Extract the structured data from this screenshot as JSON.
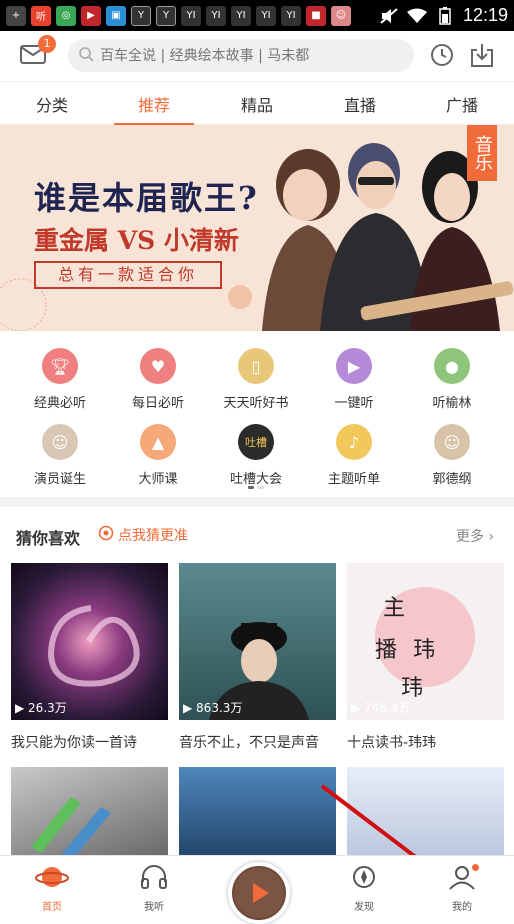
{
  "status_bar": {
    "time": "12:19",
    "left_icons": [
      "plus-icon",
      "ting-app-icon",
      "wechat-icon",
      "video-icon",
      "qr-icon",
      "y-icon",
      "y-icon",
      "yi-icon",
      "yi-icon",
      "yi-icon",
      "yi-icon",
      "yi-icon",
      "bookmark-icon",
      "face-icon"
    ]
  },
  "topbar": {
    "mail_badge": "1",
    "search_placeholder": "百车全说 | 经典绘本故事 | 马未都"
  },
  "tabs": [
    "分类",
    "推荐",
    "精品",
    "直播",
    "广播"
  ],
  "active_tab": "推荐",
  "banner": {
    "title": "谁是本届歌王?",
    "subtitle": "重金属 VS 小清新",
    "tagline": "总有一款适合你",
    "tag": "音乐"
  },
  "categories_row1": [
    {
      "label": "经典必听",
      "icon": "trophy-icon",
      "color": "#f08080"
    },
    {
      "label": "每日必听",
      "icon": "calendar-icon",
      "color": "#f08080"
    },
    {
      "label": "天天听好书",
      "icon": "book-icon",
      "color": "#e7c77a"
    },
    {
      "label": "一键听",
      "icon": "play-icon",
      "color": "#b48ad8"
    },
    {
      "label": "听榆林",
      "icon": "location-icon",
      "color": "#8fc57a"
    }
  ],
  "categories_row2": [
    {
      "label": "演员诞生",
      "icon": "actress-avatar-icon",
      "color": "#d9c6b4"
    },
    {
      "label": "大师课",
      "icon": "graduation-cap-icon",
      "color": "#f5a878"
    },
    {
      "label": "吐槽大会",
      "icon": "tucao-icon",
      "color": "#2b2b2b"
    },
    {
      "label": "主题听单",
      "icon": "music-note-icon",
      "color": "#f3c85a"
    },
    {
      "label": "郭德纲",
      "icon": "guodegang-avatar-icon",
      "color": "#d7c3a8"
    }
  ],
  "section": {
    "title": "猜你喜欢",
    "guess_label": "点我猜更准",
    "more_label": "更多"
  },
  "cards": [
    {
      "title": "我只能为你读一首诗",
      "plays": "26.3万",
      "color": "#3a2140"
    },
    {
      "title": "音乐不止，不只是声音",
      "plays": "863.3万",
      "color": "#3f6a6e"
    },
    {
      "title": "十点读书-玮玮",
      "plays": "746.4万",
      "color": "#f0ecec"
    }
  ],
  "cards_row2": [
    {
      "color": "#8a8a8a"
    },
    {
      "color": "#3b72a8"
    },
    {
      "color": "#cfd8e8"
    }
  ],
  "bottom_nav": [
    {
      "label": "首页",
      "icon": "planet-icon",
      "active": true
    },
    {
      "label": "我听",
      "icon": "headphones-icon",
      "active": false
    },
    {
      "label": "",
      "icon": "play-icon",
      "active": false
    },
    {
      "label": "发现",
      "icon": "discover-icon",
      "active": false
    },
    {
      "label": "我的",
      "icon": "person-icon",
      "active": false
    }
  ],
  "colors": {
    "accent": "#f26b3a"
  }
}
